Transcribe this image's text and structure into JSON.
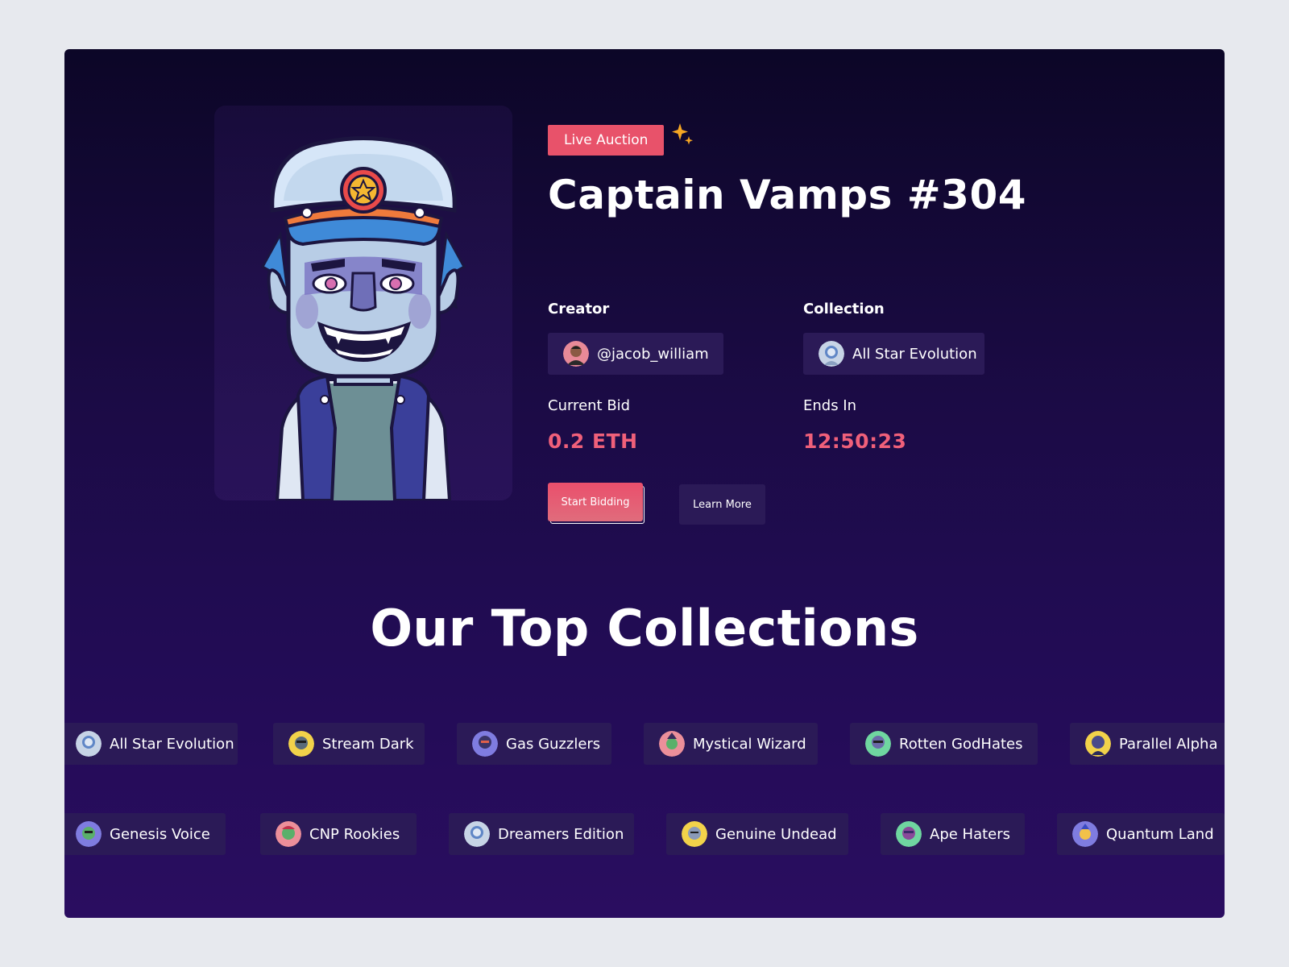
{
  "hero": {
    "badge": "Live Auction",
    "title": "Captain Vamps #304",
    "creator_label": "Creator",
    "creator_handle": "@jacob_william",
    "collection_label": "Collection",
    "collection_name": "All Star Evolution",
    "bid_label": "Current Bid",
    "bid_value": "0.2 ETH",
    "ends_label": "Ends In",
    "ends_value": "12:50:23",
    "primary_button": "Start Bidding",
    "secondary_button": "Learn More"
  },
  "top_collections": {
    "title": "Our Top Collections",
    "row1": [
      "All Star Evolution",
      "Stream Dark",
      "Gas Guzzlers",
      "Mystical Wizard",
      "Rotten GodHates",
      "Parallel Alpha"
    ],
    "row2": [
      "Genesis Voice",
      "CNP Rookies",
      "Dreamers Edition",
      "Genuine Undead",
      "Ape Haters",
      "Quantum Land"
    ]
  },
  "colors": {
    "accent": "#e8526a",
    "value": "#f0607a",
    "chip_bg": "#2b1a57",
    "sparkle": "#f5a623"
  },
  "icons": [
    "sparkle-icon",
    "avatar",
    "collection-avatar"
  ]
}
